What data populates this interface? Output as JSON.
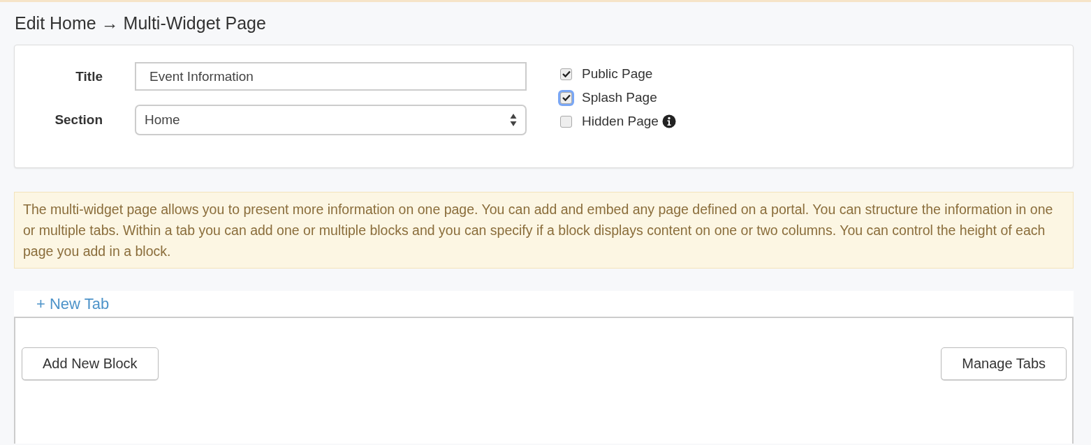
{
  "page_title": "Edit Home → Multi-Widget Page",
  "form": {
    "fields": [
      {
        "kind": "text",
        "label": "Title",
        "value": "Event Information"
      },
      {
        "kind": "select",
        "label": "Section",
        "value": "Home"
      }
    ],
    "checkboxes": [
      {
        "label": "Public Page",
        "checked": true,
        "focused": false,
        "info": false
      },
      {
        "label": "Splash Page",
        "checked": true,
        "focused": true,
        "info": false
      },
      {
        "label": "Hidden Page",
        "checked": false,
        "focused": false,
        "info": true
      }
    ]
  },
  "notice": "The multi-widget page allows you to present more information on one page. You can add and embed any page defined on a portal. You can structure the information in one or multiple tabs. Within a tab you can add one or multiple blocks and you can specify if a block displays content on one or two columns. You can control the height of each page you add in a block.",
  "tabs": {
    "new_tab_link": "+ New Tab"
  },
  "buttons": [
    "Add New Block",
    "Manage Tabs"
  ]
}
